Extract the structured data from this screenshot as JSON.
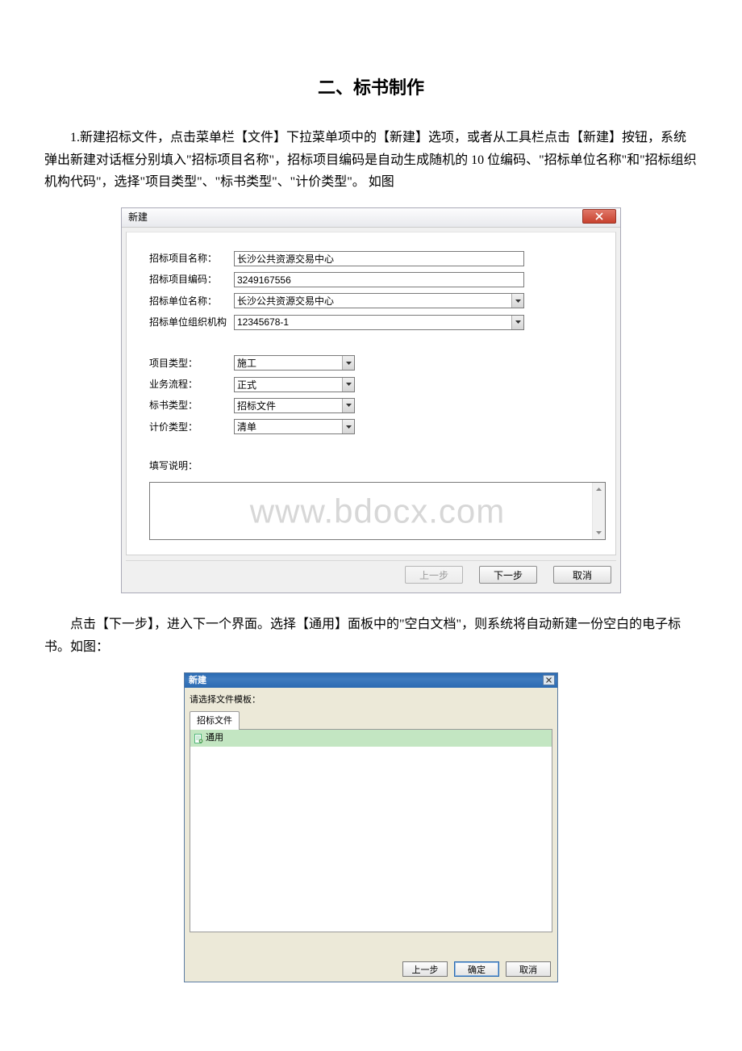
{
  "section_title": "二、标书制作",
  "paragraph1": "1.新建招标文件，点击菜单栏【文件】下拉菜单项中的【新建】选项，或者从工具栏点击【新建】按钮，系统弹出新建对话框分别填入\"招标项目名称\"，招标项目编码是自动生成随机的 10 位编码、\"招标单位名称\"和\"招标组织机构代码\"，选择\"项目类型\"、\"标书类型\"、\"计价类型\"。 如图",
  "paragraph2": "点击【下一步】，进入下一个界面。选择【通用】面板中的\"空白文档\"，则系统将自动新建一份空白的电子标书。如图：",
  "watermark": "www.bdocx.com",
  "dialog1": {
    "title": "新建",
    "labels": {
      "project_name": "招标项目名称：",
      "project_code": "招标项目编码：",
      "unit_name": "招标单位名称：",
      "org_code": "招标单位组织机构",
      "project_type": "项目类型：",
      "biz_process": "业务流程：",
      "doc_type": "标书类型：",
      "price_type": "计价类型：",
      "description": "填写说明："
    },
    "values": {
      "project_name": "长沙公共资源交易中心",
      "project_code": "3249167556",
      "unit_name": "长沙公共资源交易中心",
      "org_code": "12345678-1",
      "project_type": "施工",
      "biz_process": "正式",
      "doc_type": "招标文件",
      "price_type": "清单"
    },
    "buttons": {
      "prev": "上一步",
      "next": "下一步",
      "cancel": "取消"
    }
  },
  "dialog2": {
    "title": "新建",
    "template_label": "请选择文件模板：",
    "tab": "招标文件",
    "list_item": "通用",
    "buttons": {
      "prev": "上一步",
      "ok": "确定",
      "cancel": "取消"
    }
  }
}
